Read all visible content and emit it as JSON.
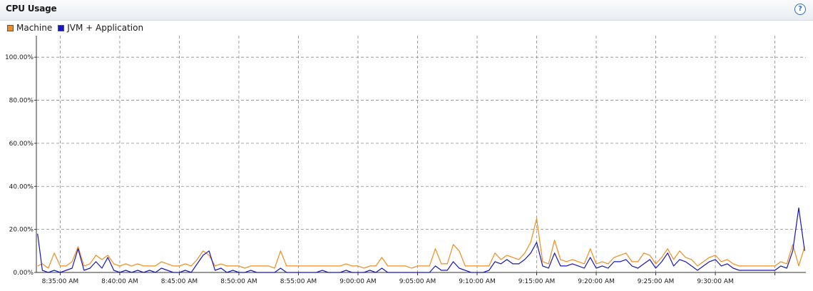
{
  "panel": {
    "title": "CPU Usage",
    "help_label": "?"
  },
  "chart_data": {
    "type": "line",
    "title": "CPU Usage",
    "xlabel": "",
    "ylabel": "",
    "ylim": [
      0,
      110
    ],
    "y_ticks": [
      0,
      20,
      40,
      60,
      80,
      100
    ],
    "y_tick_labels": [
      "0.00%",
      "20.00%",
      "40.00%",
      "60.00%",
      "80.00%",
      "100.00%"
    ],
    "x_ticks": [
      0,
      5,
      10,
      15,
      20,
      25,
      30,
      35,
      40,
      45,
      50,
      55,
      60
    ],
    "x_tick_labels": [
      "8:35:00 AM",
      "8:40:00 AM",
      "8:45:00 AM",
      "8:50:00 AM",
      "8:55:00 AM",
      "9:00:00 AM",
      "9:05:00 AM",
      "9:10:00 AM",
      "9:15:00 AM",
      "9:20:00 AM",
      "9:25:00 AM",
      "9:30:00 AM",
      ""
    ],
    "x_range_minutes": [
      -2,
      62.6
    ],
    "grid": true,
    "legend_position": "top-left",
    "series": [
      {
        "name": "Machine",
        "color": "#f28c1e",
        "x": [
          -1.9,
          -1.5,
          -1.0,
          -0.5,
          0,
          0.5,
          1.0,
          1.5,
          2.0,
          2.5,
          3.0,
          3.5,
          4.0,
          4.5,
          5.0,
          5.5,
          6.0,
          6.5,
          7.0,
          7.5,
          8.0,
          8.5,
          9.0,
          9.5,
          10.0,
          10.5,
          11.0,
          11.5,
          12.0,
          12.5,
          13.0,
          13.5,
          14.0,
          14.5,
          15.0,
          15.5,
          16.0,
          16.5,
          17.0,
          17.5,
          18.0,
          18.5,
          19.0,
          19.5,
          20.0,
          20.5,
          21.0,
          21.5,
          22.0,
          22.5,
          23.0,
          23.5,
          24.0,
          24.5,
          25.0,
          25.5,
          26.0,
          26.5,
          27.0,
          27.5,
          28.0,
          28.5,
          29.0,
          29.5,
          30.0,
          30.5,
          31.0,
          31.5,
          32.0,
          32.5,
          33.0,
          33.5,
          34.0,
          34.5,
          35.0,
          35.5,
          36.0,
          36.5,
          37.0,
          37.5,
          38.0,
          38.5,
          39.0,
          39.5,
          40.0,
          40.5,
          41.0,
          41.5,
          42.0,
          42.5,
          43.0,
          43.5,
          44.0,
          44.5,
          45.0,
          45.5,
          46.0,
          46.5,
          47.0,
          47.5,
          48.0,
          48.5,
          49.0,
          49.5,
          50.0,
          50.5,
          51.0,
          51.5,
          52.0,
          52.5,
          53.0,
          53.5,
          54.0,
          54.5,
          55.0,
          55.5,
          56.0,
          56.5,
          57.0,
          57.5,
          58.0,
          58.5,
          59.0,
          59.5,
          60.0,
          60.5,
          61.0,
          61.5,
          62.0,
          62.5
        ],
        "values": [
          3,
          4,
          2,
          9,
          3,
          3,
          5,
          12,
          3,
          4,
          8,
          6,
          8,
          4,
          3,
          4,
          3,
          4,
          3,
          3,
          3,
          5,
          4,
          3,
          3,
          4,
          3,
          6,
          10,
          8,
          3,
          4,
          3,
          3,
          3,
          2,
          3,
          3,
          3,
          3,
          2,
          10,
          3,
          3,
          3,
          3,
          3,
          3,
          3,
          3,
          3,
          3,
          4,
          3,
          3,
          2,
          3,
          3,
          7,
          3,
          3,
          3,
          3,
          2,
          3,
          3,
          3,
          11,
          4,
          4,
          13,
          10,
          3,
          3,
          3,
          3,
          3,
          9,
          6,
          8,
          7,
          6,
          9,
          14,
          25,
          5,
          4,
          15,
          6,
          5,
          6,
          5,
          4,
          11,
          4,
          5,
          4,
          7,
          8,
          9,
          5,
          5,
          9,
          8,
          4,
          7,
          11,
          6,
          10,
          7,
          6,
          3,
          5,
          7,
          8,
          5,
          6,
          4,
          3,
          3,
          3,
          3,
          3,
          3,
          3,
          5,
          4,
          13,
          3,
          12
        ]
      },
      {
        "name": "JVM + Application",
        "color": "#1717b8",
        "x": [
          -1.9,
          -1.5,
          -1.0,
          -0.5,
          0,
          0.5,
          1.0,
          1.5,
          2.0,
          2.5,
          3.0,
          3.5,
          4.0,
          4.5,
          5.0,
          5.5,
          6.0,
          6.5,
          7.0,
          7.5,
          8.0,
          8.5,
          9.0,
          9.5,
          10.0,
          10.5,
          11.0,
          11.5,
          12.0,
          12.5,
          13.0,
          13.5,
          14.0,
          14.5,
          15.0,
          15.5,
          16.0,
          16.5,
          17.0,
          17.5,
          18.0,
          18.5,
          19.0,
          19.5,
          20.0,
          20.5,
          21.0,
          21.5,
          22.0,
          22.5,
          23.0,
          23.5,
          24.0,
          24.5,
          25.0,
          25.5,
          26.0,
          26.5,
          27.0,
          27.5,
          28.0,
          28.5,
          29.0,
          29.5,
          30.0,
          30.5,
          31.0,
          31.5,
          32.0,
          32.5,
          33.0,
          33.5,
          34.0,
          34.5,
          35.0,
          35.5,
          36.0,
          36.5,
          37.0,
          37.5,
          38.0,
          38.5,
          39.0,
          39.5,
          40.0,
          40.5,
          41.0,
          41.5,
          42.0,
          42.5,
          43.0,
          43.5,
          44.0,
          44.5,
          45.0,
          45.5,
          46.0,
          46.5,
          47.0,
          47.5,
          48.0,
          48.5,
          49.0,
          49.5,
          50.0,
          50.5,
          51.0,
          51.5,
          52.0,
          52.5,
          53.0,
          53.5,
          54.0,
          54.5,
          55.0,
          55.5,
          56.0,
          56.5,
          57.0,
          57.5,
          58.0,
          58.5,
          59.0,
          59.5,
          60.0,
          60.5,
          61.0,
          61.5,
          62.0,
          62.5
        ],
        "values": [
          18,
          1,
          0,
          1,
          0,
          1,
          2,
          11,
          1,
          2,
          5,
          2,
          7,
          1,
          0,
          1,
          0,
          1,
          0,
          1,
          0,
          2,
          1,
          0,
          0,
          1,
          0,
          4,
          8,
          10,
          1,
          2,
          0,
          1,
          0,
          0,
          1,
          0,
          0,
          0,
          0,
          2,
          0,
          0,
          0,
          0,
          0,
          0,
          1,
          0,
          0,
          0,
          1,
          0,
          0,
          0,
          1,
          0,
          2,
          0,
          0,
          0,
          0,
          0,
          0,
          0,
          0,
          3,
          1,
          1,
          5,
          2,
          1,
          0,
          0,
          0,
          1,
          5,
          4,
          6,
          4,
          4,
          6,
          9,
          14,
          3,
          2,
          9,
          3,
          3,
          4,
          3,
          2,
          7,
          2,
          3,
          2,
          5,
          5,
          6,
          3,
          2,
          4,
          6,
          2,
          5,
          9,
          3,
          6,
          5,
          3,
          1,
          3,
          5,
          6,
          3,
          4,
          2,
          1,
          1,
          1,
          1,
          1,
          1,
          1,
          3,
          2,
          10,
          30,
          10
        ]
      }
    ]
  }
}
